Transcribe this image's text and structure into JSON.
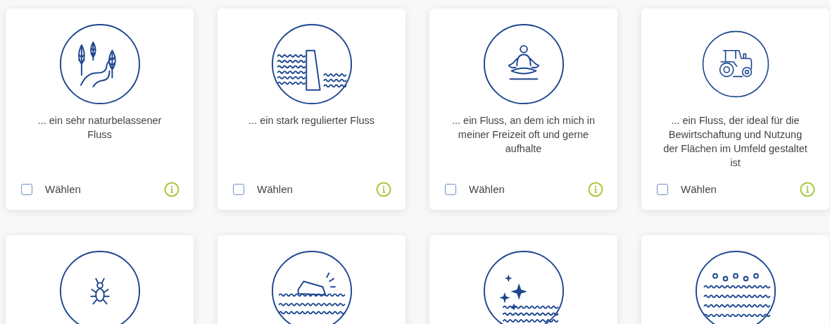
{
  "cards": [
    {
      "kind": "option",
      "text": "... ein sehr naturbelassener Fluss",
      "choose_label": "Wählen",
      "checked": false
    },
    {
      "kind": "option",
      "text": "... ein stark regulierter Fluss",
      "choose_label": "Wählen",
      "checked": false
    },
    {
      "kind": "option",
      "text": "... ein Fluss, an dem ich mich in meiner Freizeit oft und gerne aufhalte",
      "choose_label": "Wählen",
      "checked": false
    },
    {
      "kind": "option",
      "text": "... ein Fluss, der ideal für die Bewirtschaftung und Nutzung der Flächen im Umfeld gestaltet ist",
      "choose_label": "Wählen",
      "checked": false
    },
    {
      "kind": "icon_only"
    },
    {
      "kind": "icon_only"
    },
    {
      "kind": "icon_only"
    },
    {
      "kind": "icon_only"
    }
  ]
}
